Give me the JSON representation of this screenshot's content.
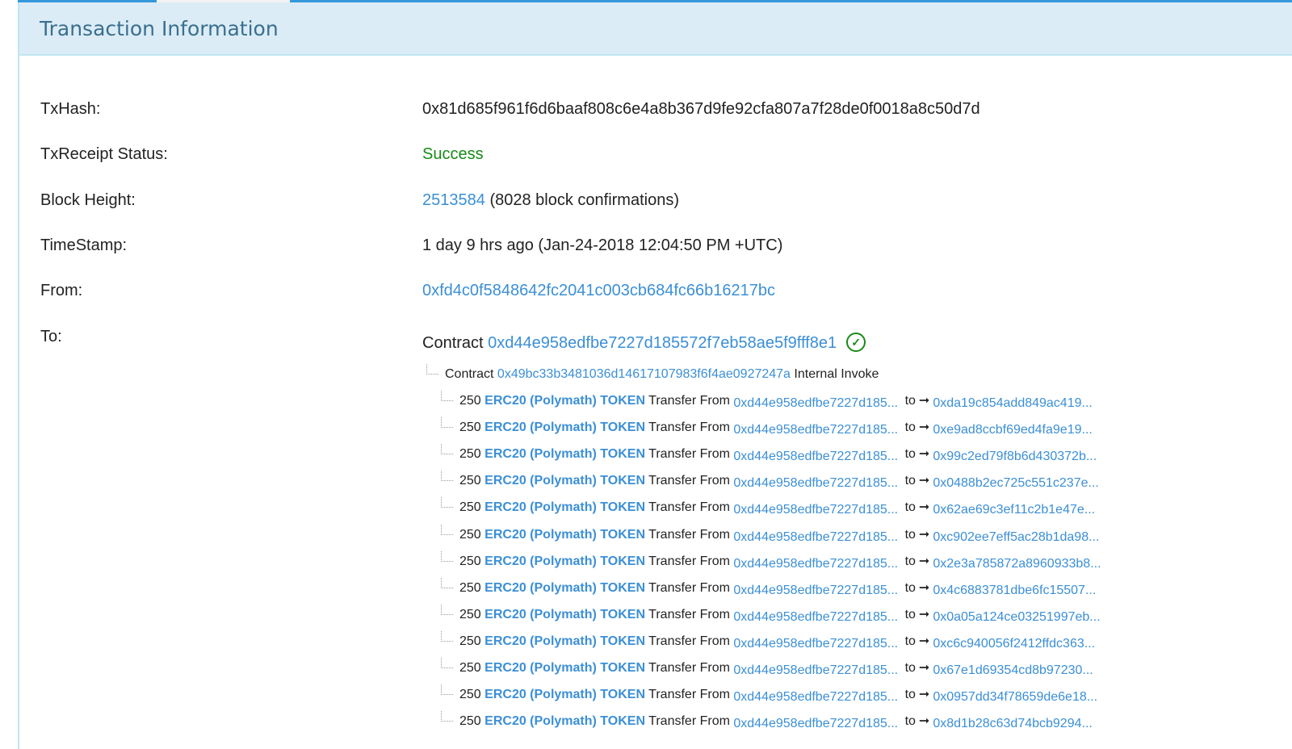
{
  "header": {
    "title": "Transaction Information"
  },
  "fields": {
    "txhash_label": "TxHash:",
    "txhash": "0x81d685f961f6d6baaf808c6e4a8b367d9fe92cfa807a7f28de0f0018a8c50d7d",
    "status_label": "TxReceipt Status:",
    "status": "Success",
    "block_label": "Block Height:",
    "block": "2513584",
    "confirmations": "(8028 block confirmations)",
    "timestamp_label": "TimeStamp:",
    "timestamp": "1 day 9 hrs ago (Jan-24-2018 12:04:50 PM +UTC)",
    "from_label": "From:",
    "from": "0xfd4c0f5848642fc2041c003cb684fc66b16217bc",
    "to_label": "To:",
    "to_prefix": "Contract",
    "to": "0xd44e958edfbe7227d185572f7eb58ae5f9fff8e1"
  },
  "internal": {
    "prefix": "Contract",
    "address": "0x49bc33b3481036d14617107983f6f4ae0927247a",
    "suffix": "Internal Invoke"
  },
  "transfer_common": {
    "amount": "250",
    "token": "ERC20 (Polymath) TOKEN",
    "text": "Transfer From",
    "from": "0xd44e958edfbe7227d185...",
    "to_word": "to",
    "arrow": "➞"
  },
  "transfers": [
    {
      "to": "0xda19c854add849ac419..."
    },
    {
      "to": "0xe9ad8ccbf69ed4fa9e19..."
    },
    {
      "to": "0x99c2ed79f8b6d430372b..."
    },
    {
      "to": "0x0488b2ec725c551c237e..."
    },
    {
      "to": "0x62ae69c3ef11c2b1e47e..."
    },
    {
      "to": "0xc902ee7eff5ac28b1da98..."
    },
    {
      "to": "0x2e3a785872a8960933b8..."
    },
    {
      "to": "0x4c6883781dbe6fc15507..."
    },
    {
      "to": "0x0a05a124ce03251997eb..."
    },
    {
      "to": "0xc6c940056f2412ffdc363..."
    },
    {
      "to": "0x67e1d69354cd8b97230..."
    },
    {
      "to": "0x0957dd34f78659de6e18..."
    },
    {
      "to": "0x8d1b28c63d74bcb9294..."
    }
  ]
}
